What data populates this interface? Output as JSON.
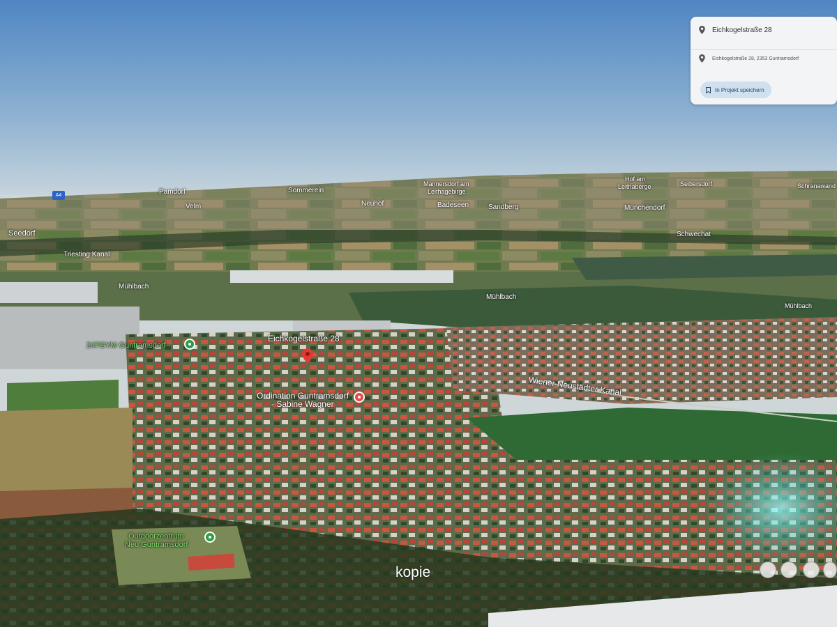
{
  "place_card": {
    "title": "Eichkogelstraße 28",
    "address": "Eichkogelstraße 28, 2353 Guntramsdorf",
    "save_button": "In Projekt speichern"
  },
  "highway_badge": "A4",
  "horizon_places": [
    "Pamdorf",
    "Velm",
    "Seedorf",
    "Sommerein",
    "Neuhof",
    "Mannersdorf am",
    "Leithagebirge",
    "Badeseen",
    "Sandberg",
    "Hof am",
    "Leithaberge",
    "Seibersdorf",
    "Schranawand",
    "Münchendorf",
    "Schwechat"
  ],
  "water_labels": [
    "Triesting Kanal",
    "Mühlbach",
    "Mühlbach",
    "Mühlbach",
    "Wiener Neustädter Kanal"
  ],
  "poi_labels": {
    "gym": "247GYM Guntramsdorf",
    "selected_address": "Eichkogelstraße 28",
    "clinic_line1": "Ordination Guntramsdorf",
    "clinic_line2": "- Sabine Wagner",
    "outdoor_line1": "Outdoorzentrum",
    "outdoor_line2": "Neu Guntramsdorf"
  },
  "watermark": "kopie",
  "colors": {
    "pin_red": "#e53935",
    "poi_green": "#2e9d45",
    "card_bg": "#f3f4f6",
    "button_bg": "#cfe0ef"
  }
}
